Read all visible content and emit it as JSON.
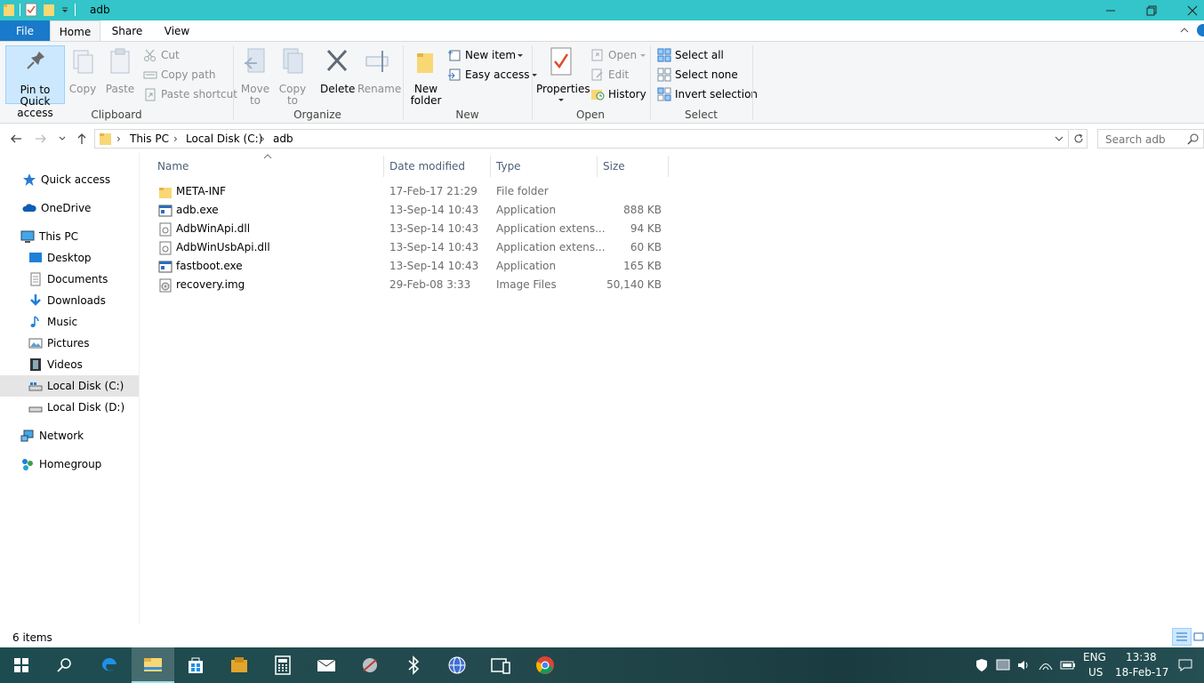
{
  "window": {
    "title": "adb"
  },
  "tabs": {
    "file": "File",
    "home": "Home",
    "share": "Share",
    "view": "View"
  },
  "ribbon": {
    "clipboard": {
      "label": "Clipboard",
      "pin_line1": "Pin to Quick",
      "pin_line2": "access",
      "copy": "Copy",
      "paste": "Paste",
      "cut": "Cut",
      "copy_path": "Copy path",
      "paste_shortcut": "Paste shortcut"
    },
    "organize": {
      "label": "Organize",
      "move_line1": "Move",
      "move_line2": "to",
      "copy_line1": "Copy",
      "copy_line2": "to",
      "delete": "Delete",
      "rename": "Rename"
    },
    "new": {
      "label": "New",
      "new_folder_line1": "New",
      "new_folder_line2": "folder",
      "new_item": "New item",
      "easy_access": "Easy access"
    },
    "open": {
      "label": "Open",
      "properties": "Properties",
      "open": "Open",
      "edit": "Edit",
      "history": "History"
    },
    "select": {
      "label": "Select",
      "select_all": "Select all",
      "select_none": "Select none",
      "invert_selection": "Invert selection"
    }
  },
  "address": {
    "crumbs": [
      "This PC",
      "Local Disk (C:)",
      "adb"
    ],
    "search_placeholder": "Search adb"
  },
  "nav": {
    "quick_access": "Quick access",
    "onedrive": "OneDrive",
    "this_pc": "This PC",
    "desktop": "Desktop",
    "documents": "Documents",
    "downloads": "Downloads",
    "music": "Music",
    "pictures": "Pictures",
    "videos": "Videos",
    "local_c": "Local Disk (C:)",
    "local_d": "Local Disk (D:)",
    "network": "Network",
    "homegroup": "Homegroup"
  },
  "columns": {
    "name": "Name",
    "date": "Date modified",
    "type": "Type",
    "size": "Size"
  },
  "files": [
    {
      "name": "META-INF",
      "date": "17-Feb-17 21:29",
      "type": "File folder",
      "size": "",
      "icon": "folder-icon"
    },
    {
      "name": "adb.exe",
      "date": "13-Sep-14 10:43",
      "type": "Application",
      "size": "888 KB",
      "icon": "application-icon"
    },
    {
      "name": "AdbWinApi.dll",
      "date": "13-Sep-14 10:43",
      "type": "Application extens...",
      "size": "94 KB",
      "icon": "dll-icon"
    },
    {
      "name": "AdbWinUsbApi.dll",
      "date": "13-Sep-14 10:43",
      "type": "Application extens...",
      "size": "60 KB",
      "icon": "dll-icon"
    },
    {
      "name": "fastboot.exe",
      "date": "13-Sep-14 10:43",
      "type": "Application",
      "size": "165 KB",
      "icon": "application-icon"
    },
    {
      "name": "recovery.img",
      "date": "29-Feb-08 3:33",
      "type": "Image Files",
      "size": "50,140 KB",
      "icon": "disc-image-icon"
    }
  ],
  "status": {
    "item_count": "6 items"
  },
  "taskbar": {
    "lang1": "ENG",
    "lang2": "US",
    "time": "13:38",
    "date": "18-Feb-17"
  },
  "colors": {
    "titlebar": "#33c5c9",
    "file_tab": "#1979ca",
    "taskbar": "#1f4e52"
  }
}
